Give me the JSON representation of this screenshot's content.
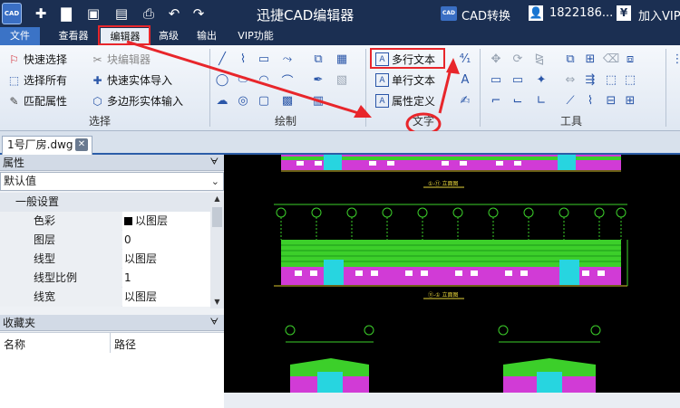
{
  "titlebar": {
    "logo_text": "CAD",
    "title": "迅捷CAD编辑器",
    "cad_badge": "CAD",
    "cad_convert": "CAD转换",
    "phone": "1822186...",
    "vip_join": "加入VIP",
    "quick_access": [
      {
        "icon": "new-file-icon",
        "glyph": "✚"
      },
      {
        "icon": "open-folder-icon",
        "glyph": "▇"
      },
      {
        "icon": "save-icon",
        "glyph": "▣"
      },
      {
        "icon": "save-as-pdf-icon",
        "glyph": "▤"
      },
      {
        "icon": "print-icon",
        "glyph": "⎙"
      },
      {
        "icon": "undo-icon",
        "glyph": "↶"
      },
      {
        "icon": "redo-icon",
        "glyph": "↷"
      }
    ]
  },
  "menu": {
    "tabs": [
      "文件",
      "查看器",
      "编辑器",
      "高级",
      "输出",
      "VIP功能"
    ],
    "active": "编辑器"
  },
  "ribbon": {
    "select_group": {
      "label": "选择",
      "quick_select": "快速选择",
      "select_all": "选择所有",
      "match_props": "匹配属性",
      "block_editor": "块编辑器",
      "quick_entity_import": "快速实体导入",
      "polygon_entity_input": "多边形实体输入"
    },
    "draw_group": {
      "label": "绘制"
    },
    "text_group": {
      "label": "文字",
      "mtext": "多行文本",
      "single_text": "单行文本",
      "attr_def": "属性定义"
    },
    "tools_group": {
      "label": "工具"
    }
  },
  "document": {
    "tab": "1号厂房.dwg",
    "close": "✕"
  },
  "properties": {
    "title": "属性",
    "pin": "ᗄ",
    "dropdown": "默认值",
    "category": "一般设置",
    "rows": [
      {
        "key": "色彩",
        "value": "以图层",
        "swatch": "#000000"
      },
      {
        "key": "图层",
        "value": "0"
      },
      {
        "key": "线型",
        "value": "以图层"
      },
      {
        "key": "线型比例",
        "value": "1"
      },
      {
        "key": "线宽",
        "value": "以图层"
      }
    ]
  },
  "favorites": {
    "title": "收藏夹",
    "col_name": "名称",
    "col_path": "路径"
  },
  "colors": {
    "dark": "#1b2f52",
    "accent": "#3b73c6",
    "highlight": "#e8262b",
    "green": "#3ccf2a",
    "magenta": "#d13bd6"
  }
}
